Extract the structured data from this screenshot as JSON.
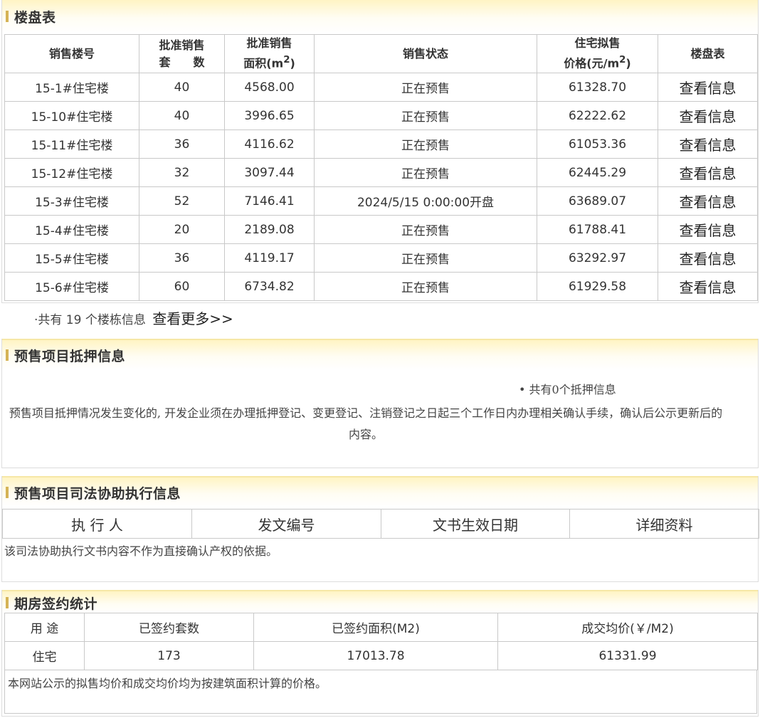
{
  "building_table": {
    "title": "楼盘表",
    "headers": {
      "building_no": "销售楼号",
      "approved_units_l1": "批准销售",
      "approved_units_l2": "套　　数",
      "approved_area_l1": "批准销售",
      "approved_area_l2": "面积(m",
      "sup2": "2",
      "approved_area_close": ")",
      "status": "销售状态",
      "price_l1": "住宅拟售",
      "price_l2": "价格(元/m",
      "price_close": ")",
      "table_link": "楼盘表"
    },
    "rows": [
      {
        "building": "15-1#住宅楼",
        "units": "40",
        "area": "4568.00",
        "status": "正在预售",
        "price": "61328.70",
        "link": "查看信息"
      },
      {
        "building": "15-10#住宅楼",
        "units": "40",
        "area": "3996.65",
        "status": "正在预售",
        "price": "62222.62",
        "link": "查看信息"
      },
      {
        "building": "15-11#住宅楼",
        "units": "36",
        "area": "4116.62",
        "status": "正在预售",
        "price": "61053.36",
        "link": "查看信息"
      },
      {
        "building": "15-12#住宅楼",
        "units": "32",
        "area": "3097.44",
        "status": "正在预售",
        "price": "62445.29",
        "link": "查看信息"
      },
      {
        "building": "15-3#住宅楼",
        "units": "52",
        "area": "7146.41",
        "status": "2024/5/15 0:00:00开盘",
        "price": "63689.07",
        "link": "查看信息"
      },
      {
        "building": "15-4#住宅楼",
        "units": "20",
        "area": "2189.08",
        "status": "正在预售",
        "price": "61788.41",
        "link": "查看信息"
      },
      {
        "building": "15-5#住宅楼",
        "units": "36",
        "area": "4119.17",
        "status": "正在预售",
        "price": "63292.97",
        "link": "查看信息"
      },
      {
        "building": "15-6#住宅楼",
        "units": "60",
        "area": "6734.82",
        "status": "正在预售",
        "price": "61929.58",
        "link": "查看信息"
      }
    ],
    "footer_text": "·共有 19 个楼栋信息",
    "more_link": "查看更多>>"
  },
  "mortgage": {
    "title": "预售项目抵押信息",
    "count_text": "• 共有0个抵押信息",
    "notice": "预售项目抵押情况发生变化的, 开发企业须在办理抵押登记、变更登记、注销登记之日起三个工作日内办理相关确认手续，确认后公示更新后的内容。"
  },
  "judicial": {
    "title": "预售项目司法协助执行信息",
    "headers": [
      "执 行 人",
      "发文编号",
      "文书生效日期",
      "详细资料"
    ],
    "notice": "该司法协助执行文书内容不作为直接确认产权的依据。"
  },
  "contract_stats": {
    "title": "期房签约统计",
    "headers": [
      "用 途",
      "已签约套数",
      "已签约面积(M2)",
      "成交均价(￥/M2)"
    ],
    "rows": [
      {
        "use": "住宅",
        "units": "173",
        "area": "17013.78",
        "avg_price": "61331.99"
      }
    ],
    "notice": "本网站公示的拟售均价和成交均价均为按建筑面积计算的价格。"
  },
  "colors": {
    "header_gradient": "#fff4c4",
    "accent_bar": "#d5b356",
    "border": "#c9c9c9"
  }
}
